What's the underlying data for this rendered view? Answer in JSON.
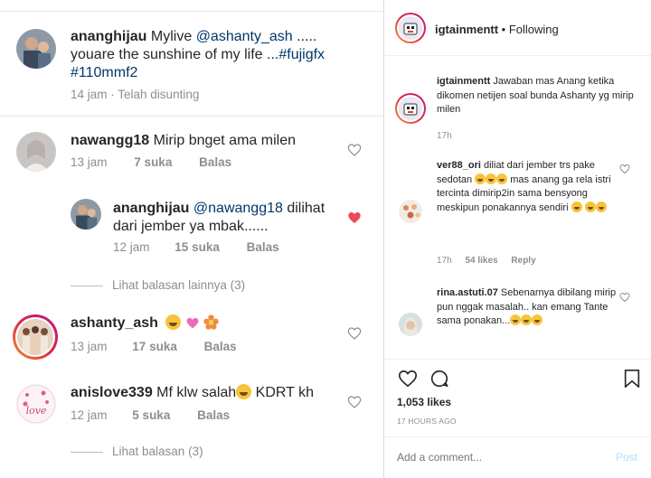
{
  "left": {
    "caption": {
      "user": "ananghijau",
      "text_before": " Mylive ",
      "mention": "@ashanty_ash",
      "text_after": " .....",
      "line2_plain": "youare the sunshine of my life ...",
      "line2_tag": "#fujigfx",
      "line3_tag": "#110mmf2",
      "meta": "14 jam  ·  Telah disunting"
    },
    "comments": [
      {
        "user": "nawangg18",
        "text": " Mirip bnget ama milen",
        "time": "13 jam",
        "likes": "7 suka",
        "reply": "Balas"
      },
      {
        "user": "ananghijau",
        "mention": "@nawangg18",
        "text": " dilihat",
        "text2": "dari jember ya mbak......",
        "time": "12 jam",
        "likes": "15 suka",
        "reply": "Balas"
      },
      {
        "user": "ashanty_ash",
        "time": "13 jam",
        "likes": "17 suka",
        "reply": "Balas"
      },
      {
        "user": "anislove339",
        "text": " Mf klw salah",
        "text2": " KDRT kh",
        "time": "12 jam",
        "likes": "5 suka",
        "reply": "Balas"
      }
    ],
    "view_replies_1": "Lihat balasan lainnya (3)",
    "view_replies_2": "Lihat balasan (3)"
  },
  "right": {
    "header": {
      "user": "igtainmentt",
      "dot": " • ",
      "follow": "Following"
    },
    "caption": {
      "user": "igtainmentt",
      "text": " Jawaban mas Anang ketika dikomen netijen soal bunda Ashanty yg mirip milen",
      "time": "17h"
    },
    "comments": [
      {
        "user": "ver88_ori",
        "text1": " diliat dari jember trs pake sedotan ",
        "text2": " mas anang ga rela istri tercinta dimirip2in sama bensyong meskipun ponakannya sendiri ",
        "time": "17h",
        "likes": "54 likes",
        "reply": "Reply"
      },
      {
        "user": "rina.astuti.07",
        "text": " Sebenarnya dibilang mirip pun nggak masalah.. kan emang Tante sama ponakan..."
      }
    ],
    "likes": "1,053 likes",
    "date": "17 HOURS AGO",
    "add_comment_placeholder": "Add a comment...",
    "post_label": "Post"
  },
  "colors": {
    "mention": "#00376b",
    "muted": "#8e8e8e",
    "liked": "#ed4956",
    "post": "#b2dffc"
  }
}
